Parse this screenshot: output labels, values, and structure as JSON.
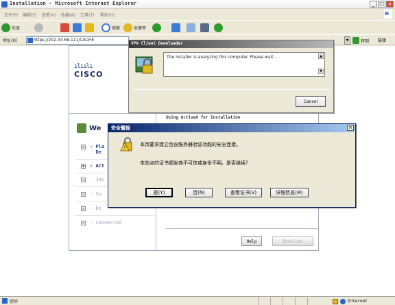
{
  "window": {
    "title": "Installation - Microsoft Internet Explorer",
    "controls": [
      "_",
      "□",
      "×"
    ]
  },
  "menu": [
    "文件(F)",
    "编辑(E)",
    "查看(V)",
    "收藏(A)",
    "工具(T)",
    "帮助(H)"
  ],
  "toolbar": {
    "back_label": "后退",
    "search_label": "搜索",
    "favorites_label": "收藏夹"
  },
  "address": {
    "label": "地址(D)",
    "url": "https://202.33.68.111/CACHE",
    "go_label": "转到",
    "links_label": "链接"
  },
  "status": {
    "text": "完毕",
    "zone": "Internet"
  },
  "cisco_page": {
    "logo_bars": "ılıılı",
    "logo_word": "CISCO",
    "welcome": "We",
    "right_heading": "Using ActiveX for Installation",
    "steps": [
      {
        "label": "Pla",
        "sub": "De",
        "state": "done",
        "check": "☑"
      },
      {
        "label": "Act",
        "state": "active",
        "check": "▪"
      },
      {
        "label": "Jav",
        "state": "pending",
        "check": "▪"
      },
      {
        "label": "Su",
        "state": "pending",
        "check": "▪"
      },
      {
        "label": "Do",
        "state": "pending",
        "check": "▪"
      },
      {
        "label": "Connected",
        "state": "pending",
        "check": "▪"
      }
    ],
    "help_label": "Help",
    "download_label": "Download"
  },
  "vpn_dialog": {
    "title": "VPN Client Downloader",
    "message": "The installer is analyzing this computer. Please wait....",
    "cancel_label": "Cancel"
  },
  "security_alert": {
    "title": "安全警报",
    "line1": "本页要求建立包含服务器验证功能的安全连接。",
    "line2": "本站点的证书颁发商不可信或身份不明。是否继续？",
    "yes_label": "是(Y)",
    "no_label": "否(N)",
    "view_cert_label": "查看证书(V)",
    "more_info_label": "详细信息(M)"
  }
}
